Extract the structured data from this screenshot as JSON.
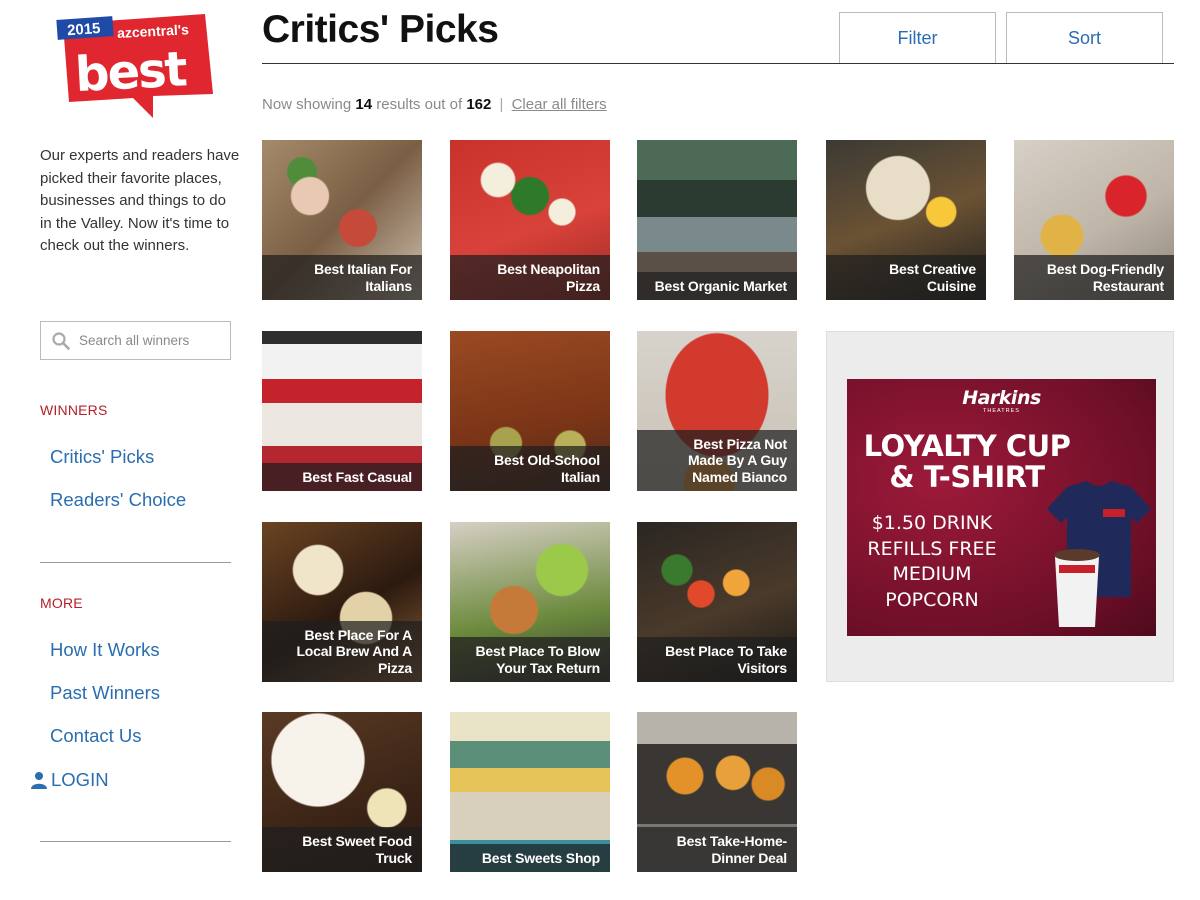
{
  "brand": {
    "year": "2015",
    "publication": "azcentral's",
    "name": "best"
  },
  "sidebar": {
    "intro": "Our experts and readers have picked their favorite places, businesses and things to do in the Valley. Now it's time to check out the winners.",
    "search_placeholder": "Search all winners",
    "winners_heading": "WINNERS",
    "winners_links": [
      "Critics' Picks",
      "Readers' Choice"
    ],
    "more_heading": "MORE",
    "more_links": [
      "How It Works",
      "Past Winners",
      "Contact Us"
    ],
    "login_label": "LOGIN"
  },
  "header": {
    "title": "Critics' Picks",
    "filter_label": "Filter",
    "sort_label": "Sort"
  },
  "results": {
    "prefix": "Now showing",
    "shown": "14",
    "middle": "results out of",
    "total": "162",
    "separator": "|",
    "clear_label": "Clear all filters"
  },
  "tiles": [
    "Best Italian For\nItalians",
    "Best Neapolitan\nPizza",
    "Best Organic Market",
    "Best Creative\nCuisine",
    "Best Dog-Friendly\nRestaurant",
    "Best Fast Casual",
    "Best Old-School\nItalian",
    "Best Pizza Not\nMade By A Guy\nNamed Bianco",
    "Best Place For A\nLocal Brew And A\nPizza",
    "Best Place To Blow\nYour Tax Return",
    "Best Place To Take\nVisitors",
    "Best Sweet Food\nTruck",
    "Best Sweets Shop",
    "Best Take-Home-\nDinner Deal"
  ],
  "ad": {
    "brand": "Harkins",
    "brand_sub": "THEATRES",
    "headline": "LOYALTY CUP & T-SHIRT",
    "offer": "$1.50 DRINK REFILLS FREE MEDIUM POPCORN"
  },
  "colors": {
    "accent_blue": "#2a6db0",
    "section_red": "#b3202a",
    "logo_red": "#e0262f",
    "logo_blue": "#1f4aa8",
    "ad_background": "#7a1230"
  },
  "icons": {
    "search": "magnifier-icon",
    "login": "user-icon"
  }
}
